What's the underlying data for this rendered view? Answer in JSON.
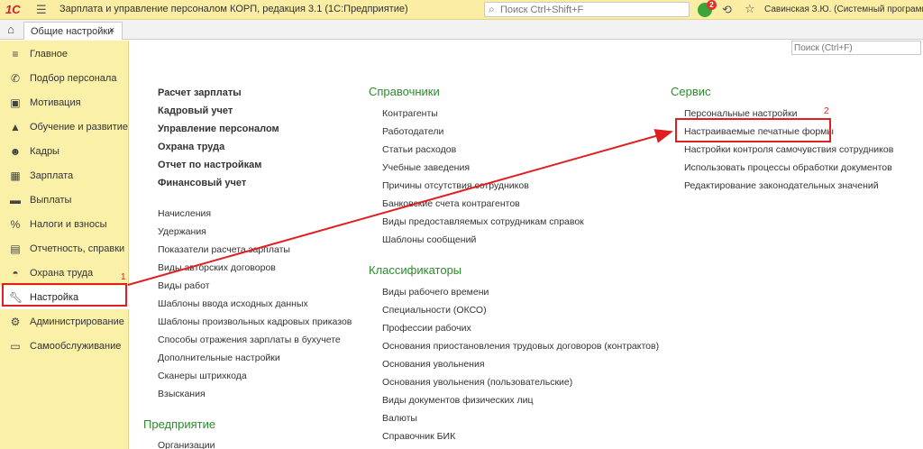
{
  "titlebar": {
    "logo": "1С",
    "app_title": "Зарплата и управление персоналом КОРП, редакция 3.1  (1С:Предприятие)",
    "search_placeholder": "Поиск Ctrl+Shift+F",
    "notifications_count": "2",
    "user": "Савинская З.Ю. (Системный программист)"
  },
  "tabs": [
    {
      "label": "Общие настройки"
    }
  ],
  "sidebar": {
    "items": [
      {
        "label": "Главное",
        "icon": "menu-icon"
      },
      {
        "label": "Подбор персонала",
        "icon": "phone-icon"
      },
      {
        "label": "Мотивация",
        "icon": "gift-icon"
      },
      {
        "label": "Обучение и развитие",
        "icon": "graduation-icon"
      },
      {
        "label": "Кадры",
        "icon": "people-icon"
      },
      {
        "label": "Зарплата",
        "icon": "calculator-icon"
      },
      {
        "label": "Выплаты",
        "icon": "wallet-icon"
      },
      {
        "label": "Налоги и взносы",
        "icon": "percent-icon"
      },
      {
        "label": "Отчетность, справки",
        "icon": "report-icon"
      },
      {
        "label": "Охрана труда",
        "icon": "helmet-icon"
      },
      {
        "label": "Настройка",
        "icon": "wrench-icon"
      },
      {
        "label": "Администрирование",
        "icon": "gear-icon"
      },
      {
        "label": "Самообслуживание",
        "icon": "id-card-icon"
      }
    ]
  },
  "main": {
    "search_placeholder": "Поиск (Ctrl+F)",
    "col1_bold": [
      "Расчет зарплаты",
      "Кадровый учет",
      "Управление персоналом",
      "Охрана труда",
      "Отчет по настройкам",
      "Финансовый учет"
    ],
    "col1_links": [
      "Начисления",
      "Удержания",
      "Показатели расчета зарплаты",
      "Виды авторских договоров",
      "Виды работ",
      "Шаблоны ввода исходных данных",
      "Шаблоны произвольных кадровых приказов",
      "Способы отражения зарплаты в бухучете",
      "Дополнительные настройки",
      "Сканеры штрихкода",
      "Взыскания"
    ],
    "enterprise": {
      "title": "Предприятие",
      "links": [
        "Организации"
      ]
    },
    "directories": {
      "title": "Справочники",
      "links": [
        "Контрагенты",
        "Работодатели",
        "Статьи расходов",
        "Учебные заведения",
        "Причины отсутствия сотрудников",
        "Банковские счета контрагентов",
        "Виды предоставляемых сотрудникам справок",
        "Шаблоны сообщений"
      ]
    },
    "classifiers": {
      "title": "Классификаторы",
      "links": [
        "Виды рабочего времени",
        "Специальности (ОКСО)",
        "Профессии рабочих",
        "Основания приостановления трудовых договоров (контрактов)",
        "Основания увольнения",
        "Основания увольнения (пользовательские)",
        "Виды документов физических лиц",
        "Валюты",
        "Справочник БИК"
      ]
    },
    "service": {
      "title": "Сервис",
      "links": [
        "Персональные настройки",
        "Настраиваемые печатные формы",
        "Настройки контроля самочувствия сотрудников",
        "Использовать процессы обработки документов",
        "Редактирование законодательных значений"
      ]
    }
  },
  "annotations": {
    "marker1": "1",
    "marker2": "2",
    "color": "#e02020"
  }
}
